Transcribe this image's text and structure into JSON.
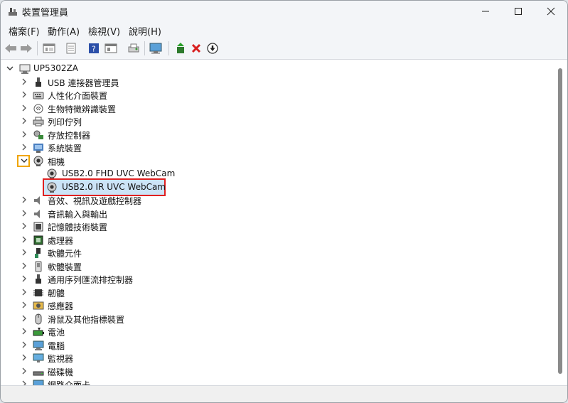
{
  "window": {
    "title": "裝置管理員"
  },
  "menu": [
    {
      "label": "檔案(F)"
    },
    {
      "label": "動作(A)"
    },
    {
      "label": "檢視(V)"
    },
    {
      "label": "說明(H)"
    }
  ],
  "tree": {
    "root": "UP5302ZA",
    "categories": [
      {
        "label": "USB 連接器管理員"
      },
      {
        "label": "人性化介面裝置"
      },
      {
        "label": "生物特徵辨識裝置"
      },
      {
        "label": "列印佇列"
      },
      {
        "label": "存放控制器"
      },
      {
        "label": "系統裝置"
      },
      {
        "label": "相機"
      },
      {
        "label": "音效、視訊及遊戲控制器"
      },
      {
        "label": "音訊輸入與輸出"
      },
      {
        "label": "記憶體技術裝置"
      },
      {
        "label": "處理器"
      },
      {
        "label": "軟體元件"
      },
      {
        "label": "軟體裝置"
      },
      {
        "label": "通用序列匯流排控制器"
      },
      {
        "label": "韌體"
      },
      {
        "label": "感應器"
      },
      {
        "label": "滑鼠及其他指標裝置"
      },
      {
        "label": "電池"
      },
      {
        "label": "電腦"
      },
      {
        "label": "監視器"
      },
      {
        "label": "磁碟機"
      },
      {
        "label": "網路介面卡"
      }
    ],
    "camera_children": [
      {
        "label": "USB2.0 FHD UVC WebCam"
      },
      {
        "label": "USB2.0 IR UVC WebCam",
        "selected": true
      }
    ]
  },
  "colors": {
    "highlight_box": "#e02020",
    "expand_box": "#f0a500",
    "selection_bg": "#cce4f7"
  }
}
